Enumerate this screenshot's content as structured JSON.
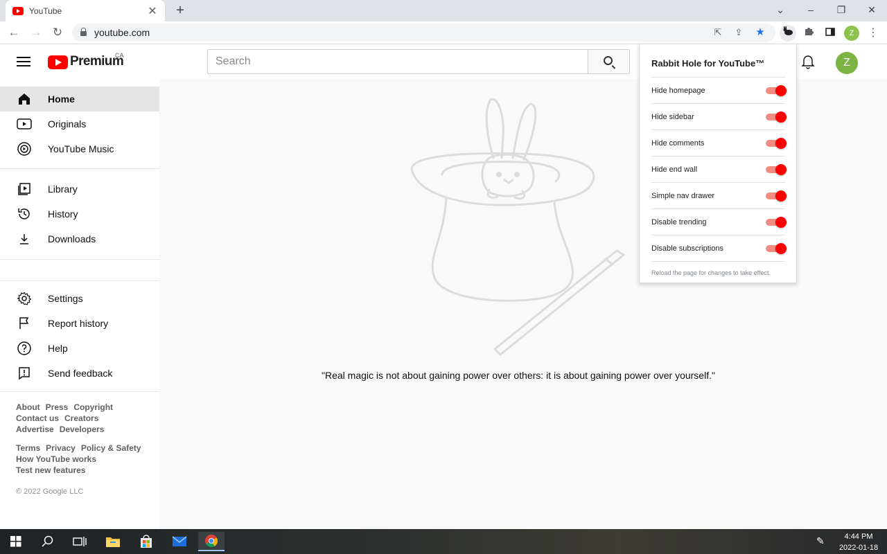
{
  "browser": {
    "tab_title": "YouTube",
    "tab_close": "✕",
    "new_tab": "+",
    "url": "youtube.com",
    "window_controls": {
      "dropdown": "⌄",
      "minimize": "–",
      "restore": "❐",
      "close": "✕"
    },
    "profile_initial": "Z",
    "menu": "⋮"
  },
  "masthead": {
    "brand": "Premium",
    "country_code": "CA",
    "search_placeholder": "Search",
    "avatar_initial": "Z"
  },
  "sidebar": {
    "section1": [
      {
        "label": "Home",
        "icon": "home-icon",
        "active": true
      },
      {
        "label": "Originals",
        "icon": "originals-icon"
      },
      {
        "label": "YouTube Music",
        "icon": "youtube-music-icon"
      }
    ],
    "section2": [
      {
        "label": "Library",
        "icon": "library-icon"
      },
      {
        "label": "History",
        "icon": "history-icon"
      },
      {
        "label": "Downloads",
        "icon": "download-icon"
      }
    ],
    "section3": [
      {
        "label": "Settings",
        "icon": "gear-icon"
      },
      {
        "label": "Report history",
        "icon": "flag-icon"
      },
      {
        "label": "Help",
        "icon": "help-icon"
      },
      {
        "label": "Send feedback",
        "icon": "feedback-icon"
      }
    ],
    "footer": {
      "links_row1": [
        "About",
        "Press",
        "Copyright"
      ],
      "links_row2": [
        "Contact us",
        "Creators"
      ],
      "links_row3": [
        "Advertise",
        "Developers"
      ],
      "links_row4": [
        "Terms",
        "Privacy",
        "Policy & Safety"
      ],
      "links_row5": [
        "How YouTube works"
      ],
      "links_row6": [
        "Test new features"
      ],
      "copyright": "© 2022 Google LLC"
    }
  },
  "main": {
    "quote": "\"Real magic is not about gaining power over others: it is about gaining power over yourself.\""
  },
  "popup": {
    "title": "Rabbit Hole for YouTube™",
    "options": [
      {
        "label": "Hide homepage",
        "enabled": true
      },
      {
        "label": "Hide sidebar",
        "enabled": true
      },
      {
        "label": "Hide comments",
        "enabled": true
      },
      {
        "label": "Hide end wall",
        "enabled": true
      },
      {
        "label": "Simple nav drawer",
        "enabled": true
      },
      {
        "label": "Disable trending",
        "enabled": true
      },
      {
        "label": "Disable subscriptions",
        "enabled": true
      }
    ],
    "note": "Reload the page for changes to take effect."
  },
  "taskbar": {
    "time": "4:44 PM",
    "date": "2022-01-18"
  },
  "colors": {
    "youtube_red": "#ff0000",
    "toggle_on": "#ff0000",
    "avatar_green": "#7cb342"
  }
}
